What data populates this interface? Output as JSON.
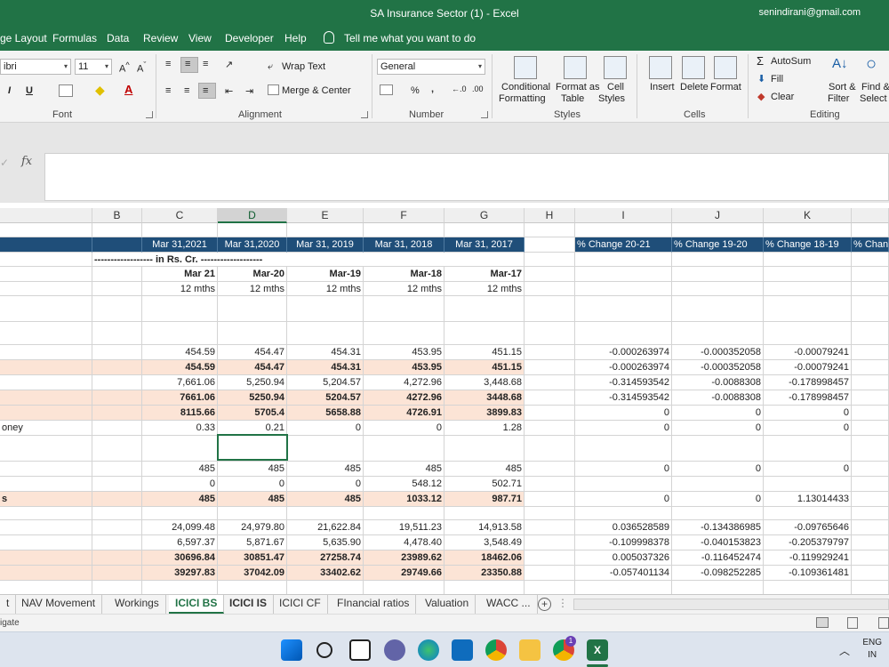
{
  "window": {
    "title": "SA Insurance Sector (1)  -  Excel",
    "account": "senindirani@gmail.com"
  },
  "ribbon_tabs": [
    "ge Layout",
    "Formulas",
    "Data",
    "Review",
    "View",
    "Developer",
    "Help",
    "Tell me what you want to do"
  ],
  "ribbon": {
    "font_name": "ibri",
    "font_size": "11",
    "wrap_text": "Wrap Text",
    "merge_center": "Merge & Center",
    "number_format": "General",
    "percent_symbol": "%",
    "comma_symbol": "‚",
    "cond_format": [
      "Conditional",
      "Formatting"
    ],
    "format_table": [
      "Format as",
      "Table"
    ],
    "cell_styles": [
      "Cell",
      "Styles"
    ],
    "insert": "Insert",
    "delete": "Delete",
    "format": "Format",
    "autosum": "AutoSum",
    "fill": "Fill",
    "clear": "Clear",
    "sort_filter": [
      "Sort &",
      "Filter"
    ],
    "find_select": [
      "Find &",
      "Select"
    ],
    "groups": [
      "Font",
      "Alignment",
      "Number",
      "Styles",
      "Cells",
      "Editing"
    ]
  },
  "formula_bar": {
    "fx": "fx",
    "value": ""
  },
  "columns": [
    "B",
    "C",
    "D",
    "E",
    "F",
    "G",
    "H",
    "I",
    "J",
    "K"
  ],
  "selected_column": "D",
  "header_band": {
    "dates": [
      "Mar 31,2021",
      "Mar 31,2020",
      "Mar 31, 2019",
      "Mar 31, 2018",
      "Mar 31, 2017"
    ],
    "changes": [
      "% Change 20-21",
      "% Change 19-20",
      "% Change 18-19",
      "% Chang"
    ]
  },
  "units_row": "------------------ in Rs. Cr. -------------------",
  "period_row": [
    "Mar 21",
    "Mar-20",
    "Mar-19",
    "Mar-18",
    "Mar-17"
  ],
  "months_row": [
    "12 mths",
    "12 mths",
    "12 mths",
    "12 mths",
    "12 mths"
  ],
  "rows": [
    {
      "label": "",
      "vals": [
        "454.59",
        "454.47",
        "454.31",
        "453.95",
        "451.15"
      ],
      "chg": [
        "-0.000263974",
        "-0.000352058",
        "-0.00079241"
      ],
      "style": ""
    },
    {
      "label": "",
      "vals": [
        "454.59",
        "454.47",
        "454.31",
        "453.95",
        "451.15"
      ],
      "chg": [
        "-0.000263974",
        "-0.000352058",
        "-0.00079241"
      ],
      "style": "peach"
    },
    {
      "label": "",
      "vals": [
        "7,661.06",
        "5,250.94",
        "5,204.57",
        "4,272.96",
        "3,448.68"
      ],
      "chg": [
        "-0.314593542",
        "-0.0088308",
        "-0.178998457"
      ],
      "style": ""
    },
    {
      "label": "",
      "vals": [
        "7661.06",
        "5250.94",
        "5204.57",
        "4272.96",
        "3448.68"
      ],
      "chg": [
        "-0.314593542",
        "-0.0088308",
        "-0.178998457"
      ],
      "style": "peach"
    },
    {
      "label": "",
      "vals": [
        "8115.66",
        "5705.4",
        "5658.88",
        "4726.91",
        "3899.83"
      ],
      "chg": [
        "0",
        "0",
        "0"
      ],
      "style": "peach"
    },
    {
      "label": "oney",
      "vals": [
        "0.33",
        "0.21",
        "0",
        "0",
        "1.28"
      ],
      "chg": [
        "0",
        "0",
        "0"
      ],
      "style": ""
    },
    {
      "label": "",
      "vals": [
        "485",
        "485",
        "485",
        "485",
        "485"
      ],
      "chg": [
        "0",
        "0",
        "0"
      ],
      "style": ""
    },
    {
      "label": "",
      "vals": [
        "0",
        "0",
        "0",
        "548.12",
        "502.71"
      ],
      "chg": [
        "",
        "",
        ""
      ],
      "style": ""
    },
    {
      "label": "s",
      "vals": [
        "485",
        "485",
        "485",
        "1033.12",
        "987.71"
      ],
      "chg": [
        "0",
        "0",
        "1.13014433"
      ],
      "style": "peach"
    },
    {
      "label": "",
      "vals": [
        "24,099.48",
        "24,979.80",
        "21,622.84",
        "19,511.23",
        "14,913.58"
      ],
      "chg": [
        "0.036528589",
        "-0.134386985",
        "-0.09765646"
      ],
      "style": ""
    },
    {
      "label": "",
      "vals": [
        "6,597.37",
        "5,871.67",
        "5,635.90",
        "4,478.40",
        "3,548.49"
      ],
      "chg": [
        "-0.109998378",
        "-0.040153823",
        "-0.205379797"
      ],
      "style": ""
    },
    {
      "label": "",
      "vals": [
        "30696.84",
        "30851.47",
        "27258.74",
        "23989.62",
        "18462.06"
      ],
      "chg": [
        "0.005037326",
        "-0.116452474",
        "-0.119929241"
      ],
      "style": "peach"
    },
    {
      "label": "",
      "vals": [
        "39297.83",
        "37042.09",
        "33402.62",
        "29749.66",
        "23350.88"
      ],
      "chg": [
        "-0.057401134",
        "-0.098252285",
        "-0.109361481"
      ],
      "style": "peach"
    }
  ],
  "sheets": [
    {
      "name": "t",
      "state": ""
    },
    {
      "name": "NAV Movement",
      "state": ""
    },
    {
      "name": "Workings",
      "state": ""
    },
    {
      "name": "ICICI BS",
      "state": "active"
    },
    {
      "name": "ICICI IS",
      "state": "bold"
    },
    {
      "name": "ICICI CF",
      "state": ""
    },
    {
      "name": "FInancial ratios",
      "state": ""
    },
    {
      "name": "Valuation",
      "state": ""
    },
    {
      "name": "WACC ...",
      "state": ""
    }
  ],
  "status_text": "igate",
  "taskbar": {
    "lang1": "ENG",
    "lang2": "IN",
    "badge": "1"
  },
  "colors": {
    "excel_green": "#217346",
    "header_band": "#1f4e79",
    "peach": "#fce4d6"
  }
}
